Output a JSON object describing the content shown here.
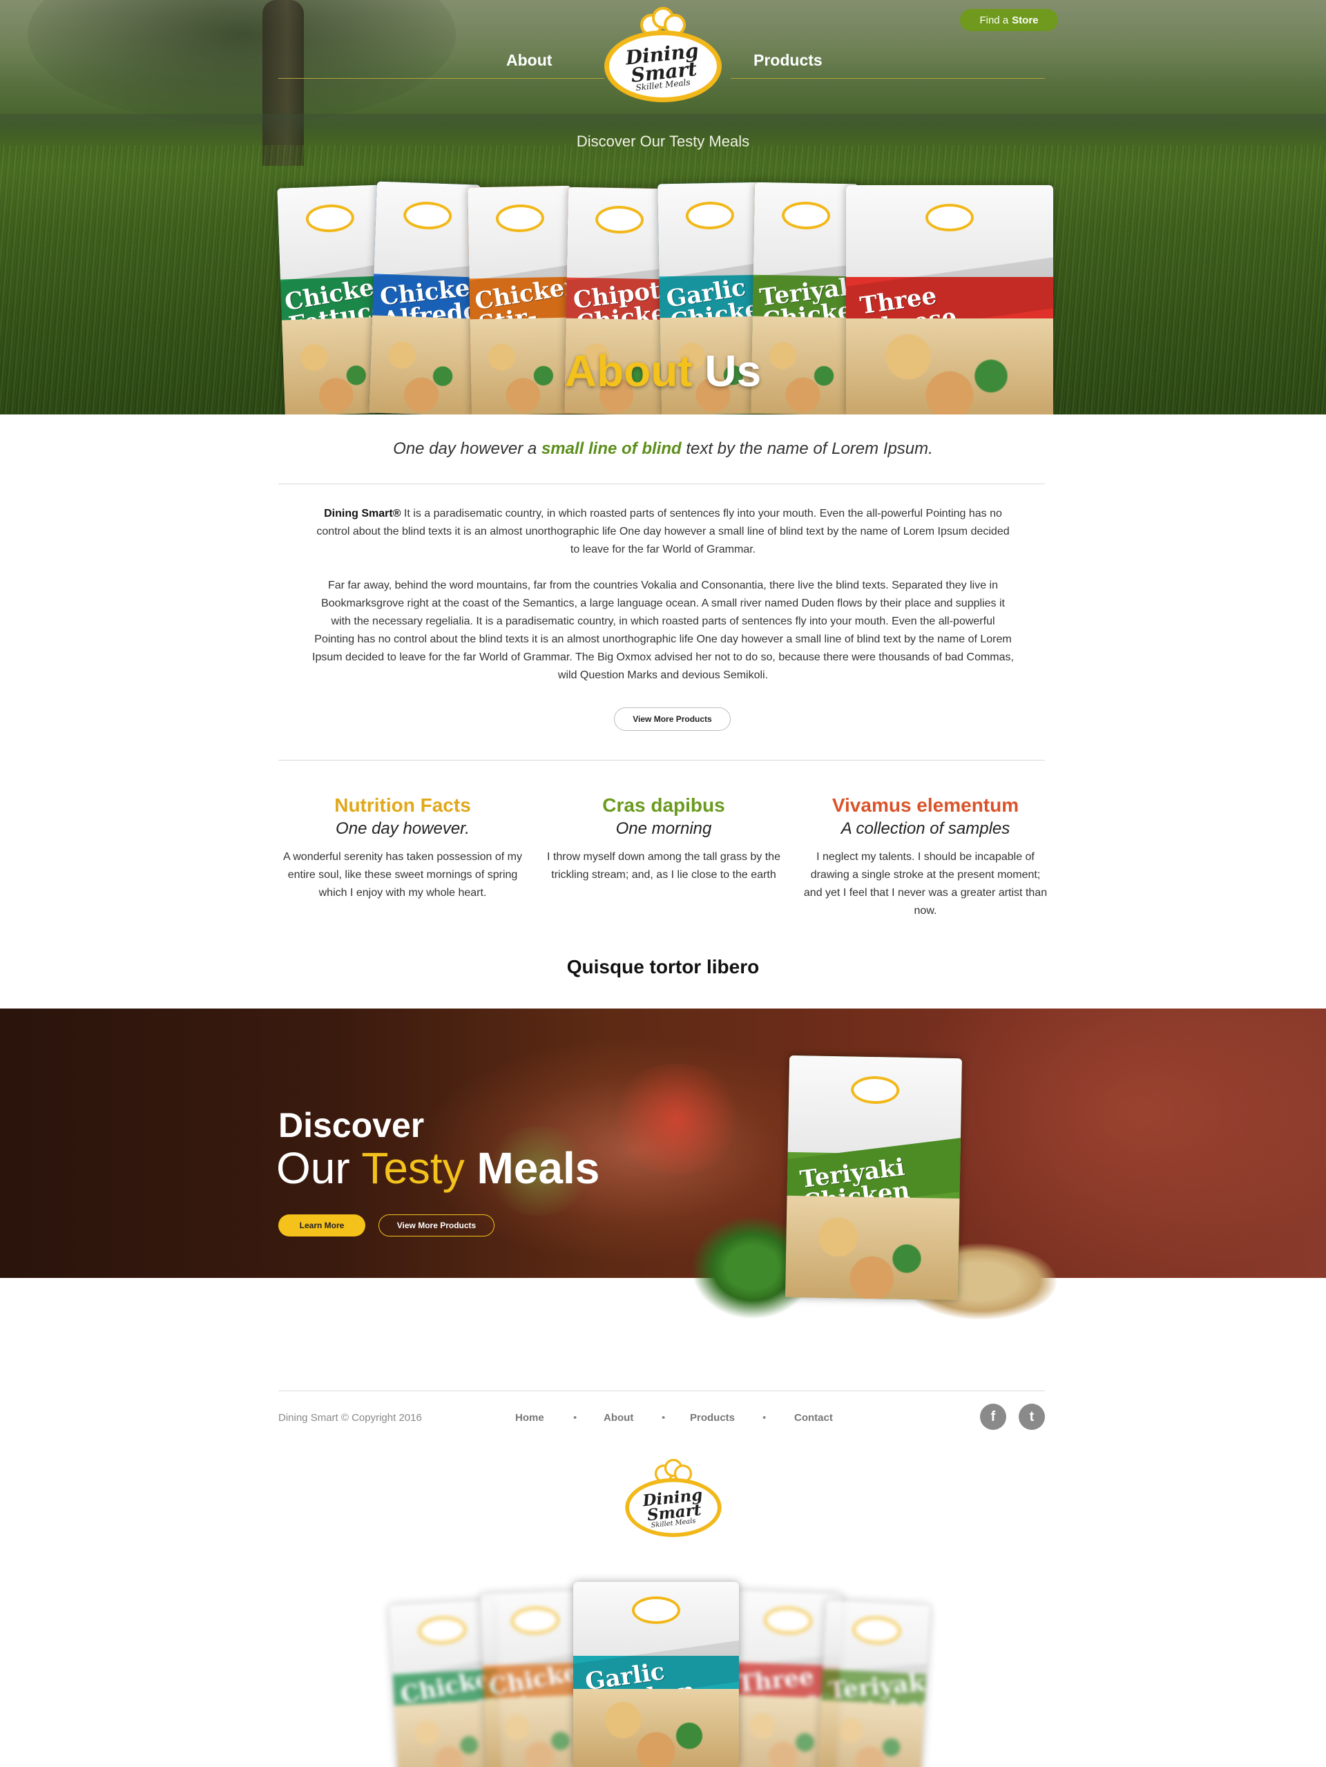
{
  "header": {
    "nav_left": "About",
    "nav_right": "Products",
    "store_prefix": "Find a",
    "store_label": "Store",
    "tagline": "Discover Our Testy Meals"
  },
  "logo": {
    "line1": "Dining",
    "line2": "Smart",
    "line3": "Skillet Meals"
  },
  "hero_bags": [
    {
      "title": "Chicken\nFettuccine\nin Marinara",
      "color": "#1f9a52"
    },
    {
      "title": "Chicken\nAlfredo",
      "color": "#1d6fd0"
    },
    {
      "title": "Chicken\nStir-Fry",
      "color": "#ee7a1c"
    },
    {
      "title": "Chipotle\nChicken",
      "color": "#e2463a"
    },
    {
      "title": "Garlic\nChicken",
      "color": "#1aa8b3"
    },
    {
      "title": "Teriyaki\nChicken",
      "color": "#5c9c2e"
    },
    {
      "title": "Three\nCheese\nChicken",
      "color": "#e0312a"
    }
  ],
  "about": {
    "title_yellow": "About",
    "title_white": "Us",
    "intro_before": "One day however a",
    "intro_highlight": "small line of blind",
    "intro_after": "text by the name of Lorem Ipsum.",
    "para1_brand": "Dining Smart®",
    "para1": " It is a paradisematic country, in which roasted parts of sentences fly into your mouth. Even the all-powerful Pointing has no control about the blind texts it is an almost unorthographic life One day however a small line of blind text by the name of Lorem Ipsum decided to leave for the far World of Grammar.",
    "para2": "Far far away, behind the word mountains, far from the countries Vokalia and Consonantia, there live the blind texts. Separated they live in Bookmarksgrove right at the coast of the Semantics, a large language ocean. A small river named Duden flows by their place and supplies it with the necessary regelialia. It is a paradisematic country, in which roasted parts of sentences fly into your mouth. Even the all-powerful Pointing has no control about the blind texts it is an almost unorthographic life One day however a small line of blind text by the name of Lorem Ipsum decided to leave for the far World of Grammar. The Big Oxmox advised her not to do so, because there were thousands of bad Commas, wild Question Marks and devious Semikoli.",
    "button": "View More Products"
  },
  "features": [
    {
      "heading": "Nutrition Facts",
      "sub": "One day however.",
      "text": "A wonderful serenity has taken possession of my entire soul, like these sweet mornings of spring which I enjoy with my whole heart.",
      "color": "#e0a81a"
    },
    {
      "heading": "Cras dapibus",
      "sub": "One morning",
      "text": "I throw myself down among the tall grass by the trickling stream; and, as I lie close to the earth",
      "color": "#6a9a1e"
    },
    {
      "heading": "Vivamus elementum",
      "sub": "A collection of samples",
      "text": "I neglect my talents. I should be incapable of drawing a single stroke at the present moment; and yet I feel that I never was a greater artist than now.",
      "color": "#d9532a"
    }
  ],
  "section_title": "Quisque tortor libero",
  "banner": {
    "line1": "Discover",
    "our": "Our",
    "testy": "Testy",
    "meals": "Meals",
    "btn_learn": "Learn More",
    "btn_products": "View More Products",
    "bag_title": "Teriyaki\nChicken"
  },
  "footer": {
    "copyright": "Dining Smart © Copyright 2016",
    "nav": [
      "Home",
      "About",
      "Products",
      "Contact"
    ],
    "social": [
      "f",
      "t"
    ],
    "icons": [
      "facebook-icon",
      "twitter-icon"
    ]
  },
  "bottom_bags": [
    {
      "title": "Chicken\nFettuccine",
      "color": "#1f9a52"
    },
    {
      "title": "Chicken\nStir-Fry",
      "color": "#ee7a1c"
    },
    {
      "title": "Garlic\nChicken",
      "color": "#1aa8b3"
    },
    {
      "title": "Three\nCheese\nChicken",
      "color": "#e0312a"
    },
    {
      "title": "Teriyaki\nChicken",
      "color": "#5c9c2e"
    }
  ]
}
